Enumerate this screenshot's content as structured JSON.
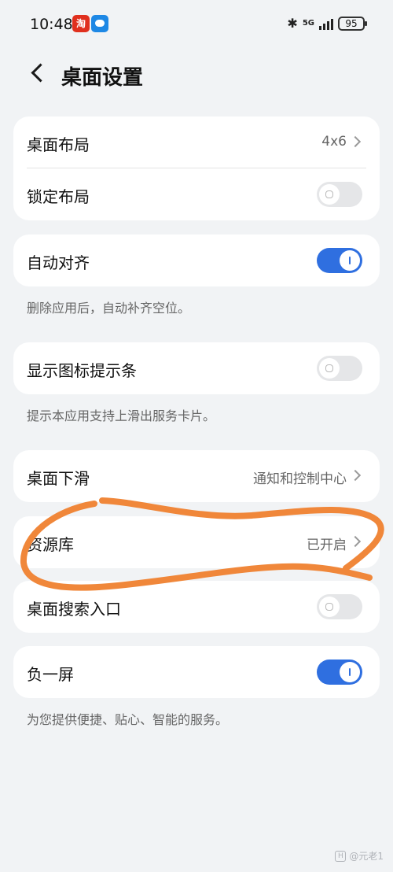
{
  "status_bar": {
    "time": "10:48",
    "network": "5G",
    "battery": "95",
    "app_badge_label": "淘"
  },
  "header": {
    "title": "桌面设置"
  },
  "groups": [
    {
      "rows": [
        {
          "label": "桌面布局",
          "value": "4x6",
          "control": "chevron"
        },
        {
          "label": "锁定布局",
          "control": "toggle",
          "enabled": false
        }
      ]
    },
    {
      "rows": [
        {
          "label": "自动对齐",
          "control": "toggle",
          "enabled": true
        }
      ],
      "hint": "删除应用后，自动补齐空位。"
    },
    {
      "rows": [
        {
          "label": "显示图标提示条",
          "control": "toggle",
          "enabled": false
        }
      ],
      "hint": "提示本应用支持上滑出服务卡片。"
    },
    {
      "rows": [
        {
          "label": "桌面下滑",
          "value": "通知和控制中心",
          "control": "chevron"
        }
      ]
    },
    {
      "rows": [
        {
          "label": "资源库",
          "value": "已开启",
          "control": "chevron"
        }
      ]
    },
    {
      "rows": [
        {
          "label": "桌面搜索入口",
          "control": "toggle",
          "enabled": false
        }
      ]
    },
    {
      "rows": [
        {
          "label": "负一屏",
          "control": "toggle",
          "enabled": true
        }
      ],
      "hint": "为您提供便捷、贴心、智能的服务。"
    }
  ],
  "annotation": {
    "color": "#f0873a",
    "target": "资源库"
  },
  "watermark": {
    "text": "@元老1"
  },
  "colors": {
    "background": "#f1f3f5",
    "card": "#ffffff",
    "toggle_on": "#2f6fe0",
    "toggle_off": "#e5e6e8"
  }
}
